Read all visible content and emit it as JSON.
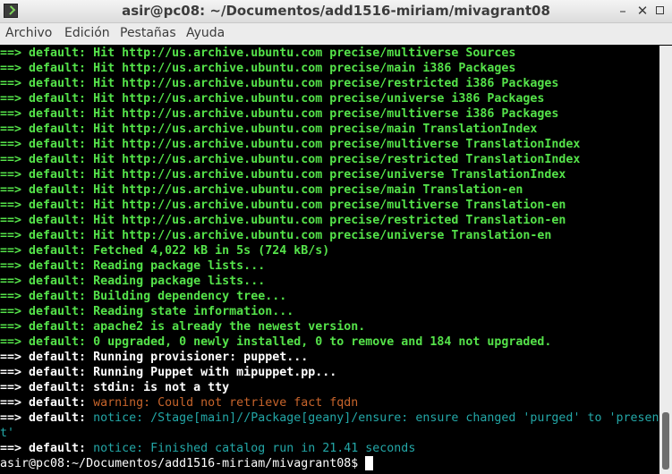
{
  "window": {
    "title": "asir@pc08: ~/Documentos/add1516-miriam/mivagrant08"
  },
  "menu": [
    "Archivo",
    "Edición",
    "Pestañas",
    "Ayuda"
  ],
  "colors": {
    "green": "#55e34a",
    "white": "#ffffff",
    "orange": "#c7642b",
    "cyan": "#23a7a7"
  },
  "terminal": {
    "lines": [
      [
        {
          "t": "==> default: Hit http://us.archive.ubuntu.com precise/multiverse Sources",
          "c": "g"
        }
      ],
      [
        {
          "t": "==> default: Hit http://us.archive.ubuntu.com precise/main i386 Packages",
          "c": "g"
        }
      ],
      [
        {
          "t": "==> default: Hit http://us.archive.ubuntu.com precise/restricted i386 Packages",
          "c": "g"
        }
      ],
      [
        {
          "t": "==> default: Hit http://us.archive.ubuntu.com precise/universe i386 Packages",
          "c": "g"
        }
      ],
      [
        {
          "t": "==> default: Hit http://us.archive.ubuntu.com precise/multiverse i386 Packages",
          "c": "g"
        }
      ],
      [
        {
          "t": "==> default: Hit http://us.archive.ubuntu.com precise/main TranslationIndex",
          "c": "g"
        }
      ],
      [
        {
          "t": "==> default: Hit http://us.archive.ubuntu.com precise/multiverse TranslationIndex",
          "c": "g"
        }
      ],
      [
        {
          "t": "==> default: Hit http://us.archive.ubuntu.com precise/restricted TranslationIndex",
          "c": "g"
        }
      ],
      [
        {
          "t": "==> default: Hit http://us.archive.ubuntu.com precise/universe TranslationIndex",
          "c": "g"
        }
      ],
      [
        {
          "t": "==> default: Hit http://us.archive.ubuntu.com precise/main Translation-en",
          "c": "g"
        }
      ],
      [
        {
          "t": "==> default: Hit http://us.archive.ubuntu.com precise/multiverse Translation-en",
          "c": "g"
        }
      ],
      [
        {
          "t": "==> default: Hit http://us.archive.ubuntu.com precise/restricted Translation-en",
          "c": "g"
        }
      ],
      [
        {
          "t": "==> default: Hit http://us.archive.ubuntu.com precise/universe Translation-en",
          "c": "g"
        }
      ],
      [
        {
          "t": "==> default: Fetched 4,022 kB in 5s (724 kB/s)",
          "c": "g"
        }
      ],
      [
        {
          "t": "==> default: Reading package lists...",
          "c": "g"
        }
      ],
      [
        {
          "t": "==> default: Reading package lists...",
          "c": "g"
        }
      ],
      [
        {
          "t": "==> default: Building dependency tree...",
          "c": "g"
        }
      ],
      [
        {
          "t": "==> default: Reading state information...",
          "c": "g"
        }
      ],
      [
        {
          "t": "==> default: apache2 is already the newest version.",
          "c": "g"
        }
      ],
      [
        {
          "t": "==> default: 0 upgraded, 0 newly installed, 0 to remove and 184 not upgraded.",
          "c": "g"
        }
      ],
      [
        {
          "t": "==> default: Running provisioner: puppet...",
          "c": "w"
        }
      ],
      [
        {
          "t": "==> default: Running Puppet with mipuppet.pp...",
          "c": "w"
        }
      ],
      [
        {
          "t": "==> default: stdin: is not a tty",
          "c": "w"
        }
      ],
      [
        {
          "t": "==> default: ",
          "c": "w"
        },
        {
          "t": "warning: Could not retrieve fact fqdn",
          "c": "o"
        }
      ],
      [
        {
          "t": "==> default: ",
          "c": "w"
        },
        {
          "t": "notice: /Stage[main]//Package[geany]/ensure: ensure changed 'purged' to 'presen",
          "c": "c"
        }
      ],
      [
        {
          "t": "t'",
          "c": "c"
        }
      ],
      [
        {
          "t": "==> default: ",
          "c": "w"
        },
        {
          "t": "notice: Finished catalog run in 21.41 seconds",
          "c": "c"
        }
      ]
    ],
    "prompt": "asir@pc08:~/Documentos/add1516-miriam/mivagrant08$"
  }
}
